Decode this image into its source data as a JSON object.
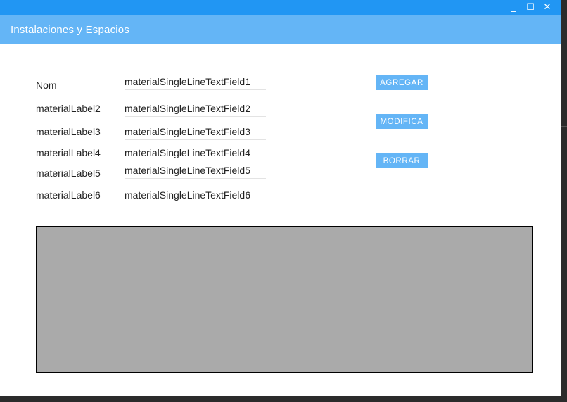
{
  "window": {
    "minimize_glyph": "_",
    "maximize_glyph": "☐",
    "close_glyph": "✕"
  },
  "header": {
    "title": "Instalaciones y Espacios"
  },
  "form": {
    "rows": [
      {
        "label": "Nom",
        "value": "materialSingleLineTextField1"
      },
      {
        "label": "materialLabel2",
        "value": "materialSingleLineTextField2"
      },
      {
        "label": "materialLabel3",
        "value": "materialSingleLineTextField3"
      },
      {
        "label": "materialLabel4",
        "value": "materialSingleLineTextField4"
      },
      {
        "label": "materialLabel5",
        "value": "materialSingleLineTextField5"
      },
      {
        "label": "materialLabel6",
        "value": "materialSingleLineTextField6"
      }
    ]
  },
  "actions": {
    "add_label": "AGREGAR",
    "modify_label": "MODIFICA",
    "delete_label": "BORRAR"
  },
  "colors": {
    "titlebar": "#2196f3",
    "header": "#64b5f6",
    "button": "#64b5f6",
    "grid_background": "#aaaaaa"
  }
}
